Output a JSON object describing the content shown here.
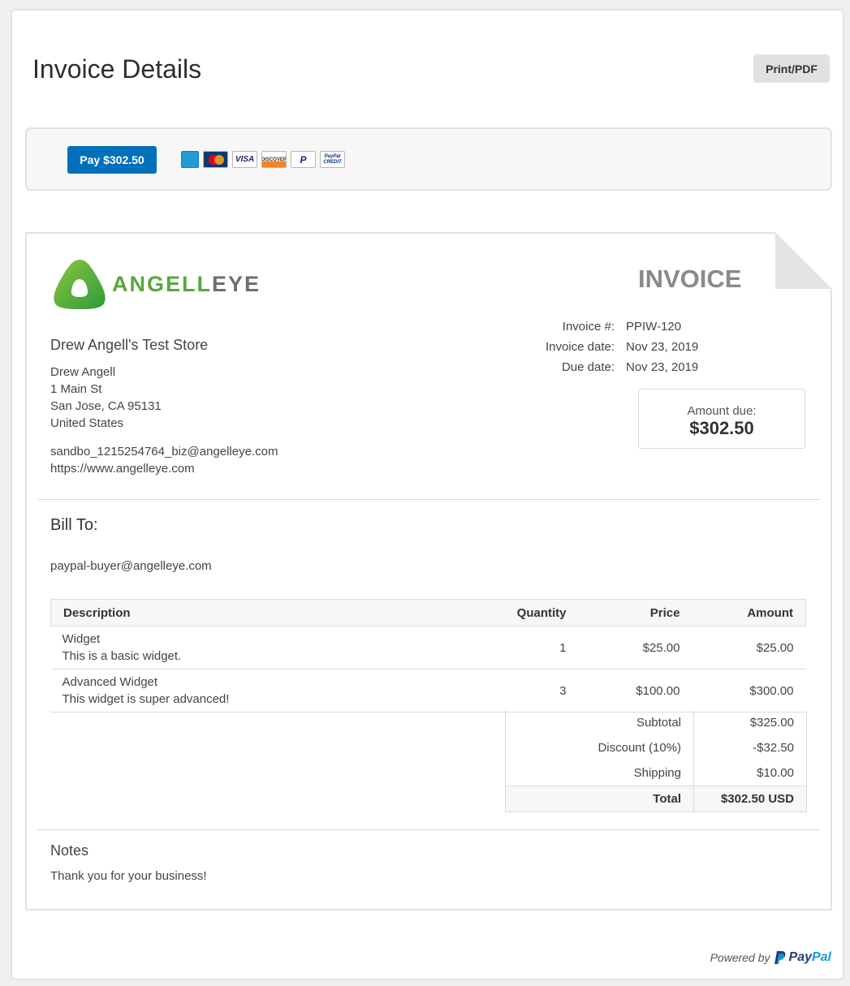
{
  "header": {
    "title": "Invoice Details",
    "print_label": "Print/PDF"
  },
  "payment": {
    "pay_label": "Pay $302.50",
    "cards": [
      {
        "name": "amex-icon"
      },
      {
        "name": "mastercard-icon",
        "text": "MasterCard"
      },
      {
        "name": "visa-icon",
        "text": "VISA"
      },
      {
        "name": "discover-icon",
        "text": "DISCOVER"
      },
      {
        "name": "paypal-icon",
        "text": "P"
      },
      {
        "name": "paypal-credit-icon",
        "text": "PayPal CREDIT"
      }
    ]
  },
  "invoice": {
    "logo": {
      "green": "ANGELL",
      "gray": "EYE"
    },
    "heading": "INVOICE",
    "merchant": {
      "store_name": "Drew Angell's Test Store",
      "name": "Drew Angell",
      "street": "1 Main St",
      "city": "San Jose, CA 95131",
      "country": "United States",
      "email": "sandbo_1215254764_biz@angelleye.com",
      "website": "https://www.angelleye.com"
    },
    "meta": [
      {
        "label": "Invoice #:",
        "value": "PPIW-120"
      },
      {
        "label": "Invoice date:",
        "value": "Nov 23, 2019"
      },
      {
        "label": "Due date:",
        "value": "Nov 23, 2019"
      }
    ],
    "amount_due_label": "Amount due:",
    "amount_due": "$302.50",
    "bill_to_heading": "Bill To:",
    "bill_to_email": "paypal-buyer@angelleye.com",
    "columns": {
      "description": "Description",
      "quantity": "Quantity",
      "price": "Price",
      "amount": "Amount"
    },
    "items": [
      {
        "name": "Widget",
        "desc": "This is a basic widget.",
        "qty": "1",
        "price": "$25.00",
        "amount": "$25.00"
      },
      {
        "name": "Advanced Widget",
        "desc": "This widget is super advanced!",
        "qty": "3",
        "price": "$100.00",
        "amount": "$300.00"
      }
    ],
    "totals": [
      {
        "label": "Subtotal",
        "value": "$325.00"
      },
      {
        "label": "Discount (10%)",
        "value": "-$32.50"
      },
      {
        "label": "Shipping",
        "value": "$10.00"
      }
    ],
    "total_label": "Total",
    "total_value": "$302.50 USD",
    "notes_heading": "Notes",
    "notes_text": "Thank you for your business!"
  },
  "footer": {
    "powered_by": "Powered by",
    "brand_pay": "Pay",
    "brand_pal": "Pal"
  },
  "colors": {
    "primary": "#0070ba",
    "logo_green": "#5aa63a",
    "logo_gray": "#6d6e71",
    "paypal_dark": "#253b80",
    "paypal_light": "#179bd7"
  }
}
